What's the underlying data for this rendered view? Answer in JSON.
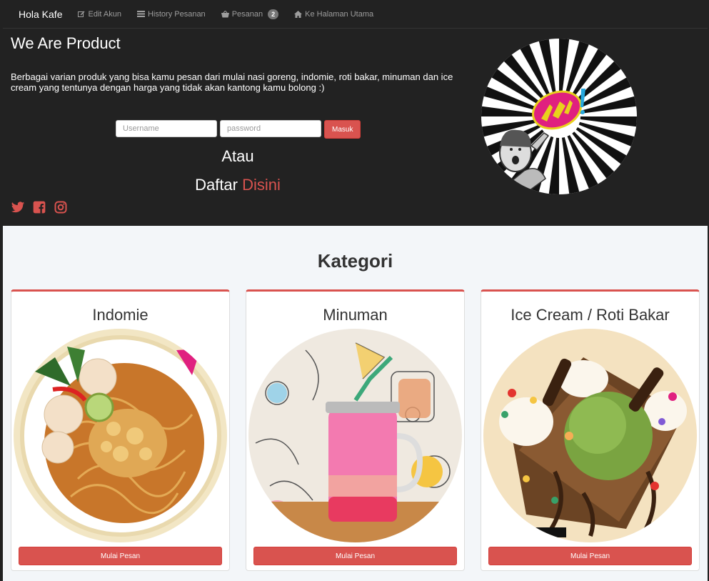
{
  "navbar": {
    "brand": "Hola Kafe",
    "items": [
      {
        "icon": "edit-icon",
        "label": "Edit Akun"
      },
      {
        "icon": "list-icon",
        "label": "History Pesanan"
      },
      {
        "icon": "basket-icon",
        "label": "Pesanan",
        "badge": "2"
      },
      {
        "icon": "home-icon",
        "label": "Ke Halaman Utama"
      }
    ]
  },
  "hero": {
    "title": "We Are Product",
    "description": "Berbagai varian produk yang bisa kamu pesan dari mulai nasi goreng, indomie, roti bakar, minuman dan ice cream yang tentunya dengan harga yang tidak akan kantong kamu bolong :)",
    "username_placeholder": "Username",
    "password_placeholder": "password",
    "login_button": "Masuk",
    "or_text": "Atau",
    "register_prefix": "Daftar",
    "register_link": "Disini",
    "social": [
      "twitter-icon",
      "facebook-icon",
      "instagram-icon"
    ]
  },
  "section_title": "Kategori",
  "categories": [
    {
      "title": "Indomie",
      "button": "Mulai Pesan"
    },
    {
      "title": "Minuman",
      "button": "Mulai Pesan"
    },
    {
      "title": "Ice Cream / Roti Bakar",
      "button": "Mulai Pesan"
    }
  ],
  "colors": {
    "accent": "#d9534f",
    "navbar": "#222222",
    "page_bg": "#f3f6f9"
  }
}
